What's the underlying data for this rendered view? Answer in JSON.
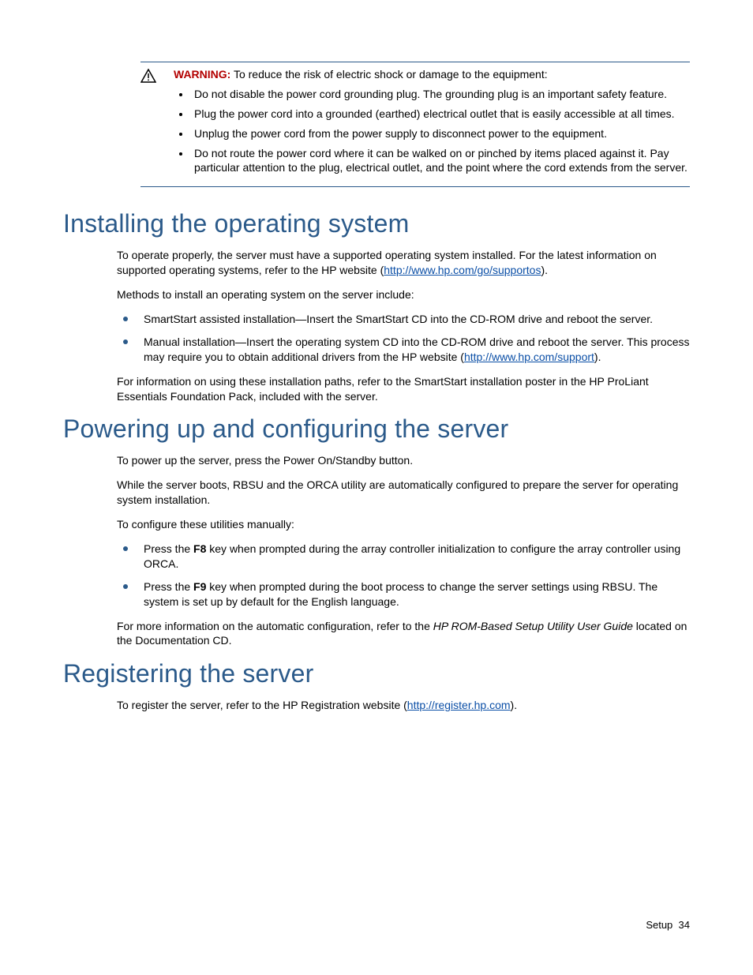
{
  "warning": {
    "label": "WARNING:",
    "intro": "To reduce the risk of electric shock or damage to the equipment:",
    "items": [
      "Do not disable the power cord grounding plug. The grounding plug is an important safety feature.",
      "Plug the power cord into a grounded (earthed) electrical outlet that is easily accessible at all times.",
      "Unplug the power cord from the power supply to disconnect power to the equipment.",
      "Do not route the power cord where it can be walked on or pinched by items placed against it. Pay particular attention to the plug, electrical outlet, and the point where the cord extends from the server."
    ]
  },
  "sections": {
    "installing": {
      "heading": "Installing the operating system",
      "p1a": "To operate properly, the server must have a supported operating system installed. For the latest information on supported operating systems, refer to the HP website (",
      "link1": "http://www.hp.com/go/supportos",
      "p1b": ").",
      "p2": "Methods to install an operating system on the server include:",
      "bullets": [
        "SmartStart assisted installation—Insert the SmartStart CD into the CD-ROM drive and reboot the server.",
        "Manual installation—Insert the operating system CD into the CD-ROM drive and reboot the server. This process may require you to obtain additional drivers from the HP website ("
      ],
      "bullet2_link": "http://www.hp.com/support",
      "bullet2_tail": ").",
      "p3": "For information on using these installation paths, refer to the SmartStart installation poster in the HP ProLiant Essentials Foundation Pack, included with the server."
    },
    "powering": {
      "heading": "Powering up and configuring the server",
      "p1": "To power up the server, press the Power On/Standby button.",
      "p2": "While the server boots, RBSU and the ORCA utility are automatically configured to prepare the server for operating system installation.",
      "p3": "To configure these utilities manually:",
      "b1_pre": "Press the ",
      "b1_key": "F8",
      "b1_post": " key when prompted during the array controller initialization to configure the array controller using ORCA.",
      "b2_pre": "Press the ",
      "b2_key": "F9",
      "b2_post": " key when prompted during the boot process to change the server settings using RBSU. The system is set up by default for the English language.",
      "p4_pre": "For more information on the automatic configuration, refer to the ",
      "p4_italic": "HP ROM-Based Setup Utility User Guide",
      "p4_post": " located on the Documentation CD."
    },
    "registering": {
      "heading": "Registering the server",
      "p1_pre": "To register the server, refer to the HP Registration website (",
      "link": "http://register.hp.com",
      "p1_post": ")."
    }
  },
  "footer": {
    "section": "Setup",
    "page": "34"
  }
}
